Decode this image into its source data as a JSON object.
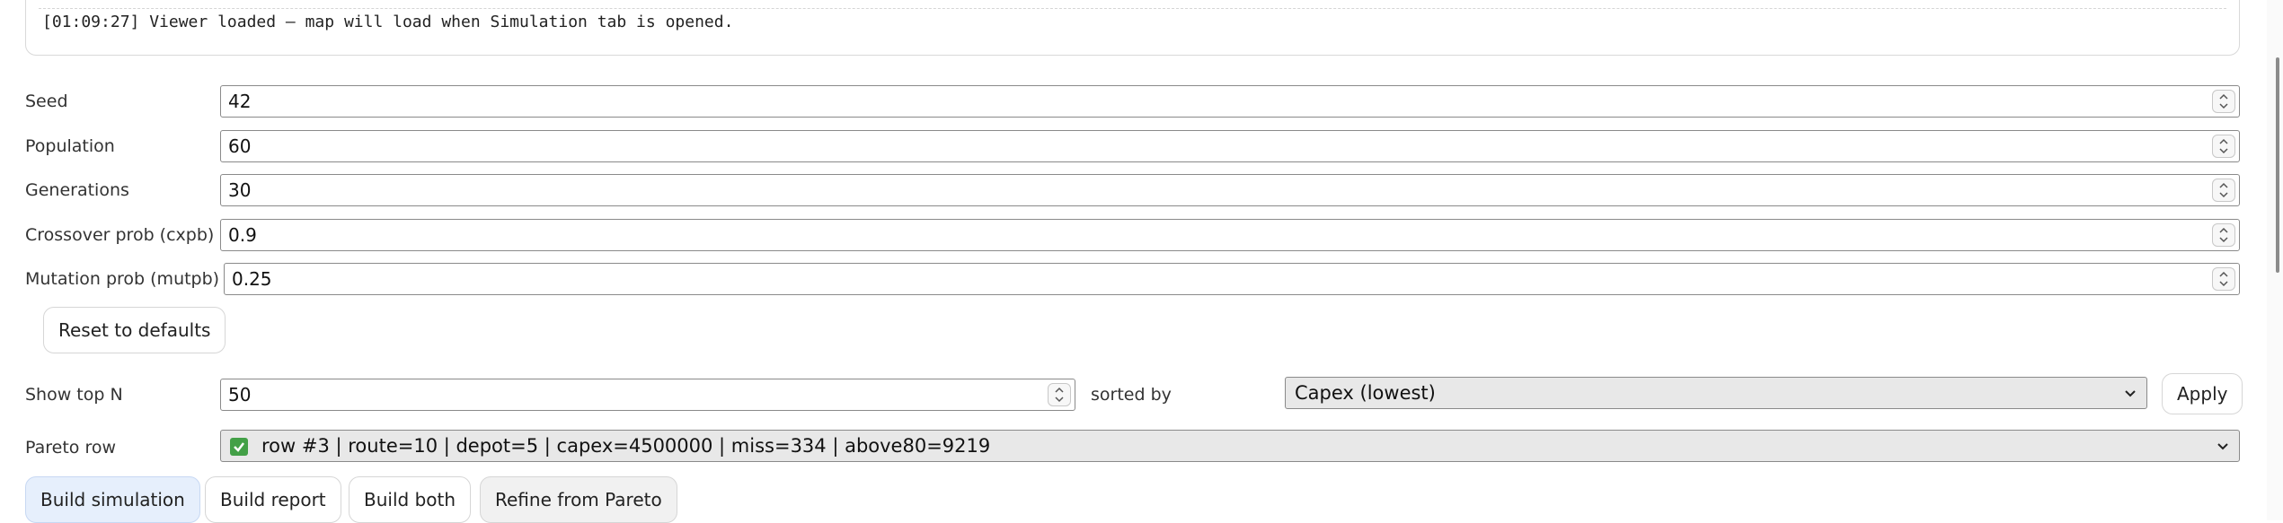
{
  "log": {
    "message": "[01:09:27] Viewer loaded – map will load when Simulation tab is opened."
  },
  "params": [
    {
      "label": "Seed",
      "value": "42"
    },
    {
      "label": "Population",
      "value": "60"
    },
    {
      "label": "Generations",
      "value": "30"
    },
    {
      "label": "Crossover prob (cxpb)",
      "value": "0.9"
    },
    {
      "label": "Mutation prob (mutpb)",
      "value": "0.25"
    }
  ],
  "reset_label": "Reset to defaults",
  "top_n": {
    "label": "Show top N",
    "value": "50",
    "sorted_by_label": "sorted by",
    "sort_value": "Capex (lowest)",
    "apply_label": "Apply"
  },
  "pareto": {
    "label": "Pareto row",
    "value": "row #3 | route=10 | depot=5 | capex=4500000 | miss=334 | above80=9219"
  },
  "actions": {
    "build_simulation": "Build simulation",
    "build_report": "Build report",
    "build_both": "Build both",
    "refine": "Refine from Pareto"
  }
}
